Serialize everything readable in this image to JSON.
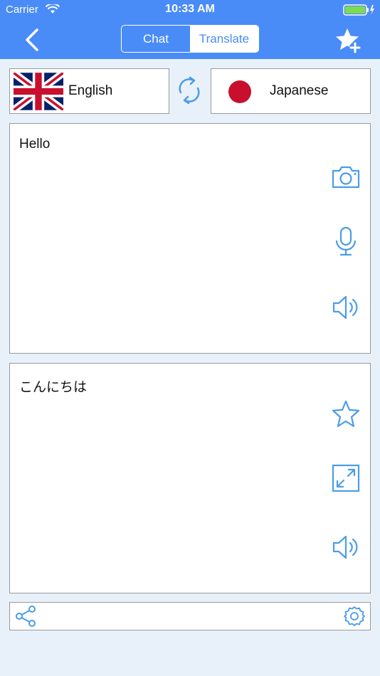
{
  "status_bar": {
    "carrier": "Carrier",
    "time": "10:33 AM"
  },
  "header": {
    "tabs": [
      {
        "label": "Chat",
        "selected": false
      },
      {
        "label": "Translate",
        "selected": true
      }
    ],
    "accent_color": "#4a8cf7",
    "icons": {
      "back": "chevron-left-icon",
      "favorite_add": "star-plus-icon"
    }
  },
  "languages": {
    "source": {
      "name": "English",
      "flag": "uk-flag"
    },
    "target": {
      "name": "Japanese",
      "flag": "japan-flag"
    },
    "swap_icon": "swap-arrows-icon"
  },
  "source_panel": {
    "text": "Hello",
    "icons": [
      "camera-icon",
      "microphone-icon",
      "speaker-icon"
    ]
  },
  "target_panel": {
    "text": "こんにちは",
    "icons": [
      "star-icon",
      "expand-icon",
      "speaker-icon"
    ]
  },
  "bottom_bar": {
    "icons": [
      "share-icon",
      "settings-icon"
    ]
  }
}
